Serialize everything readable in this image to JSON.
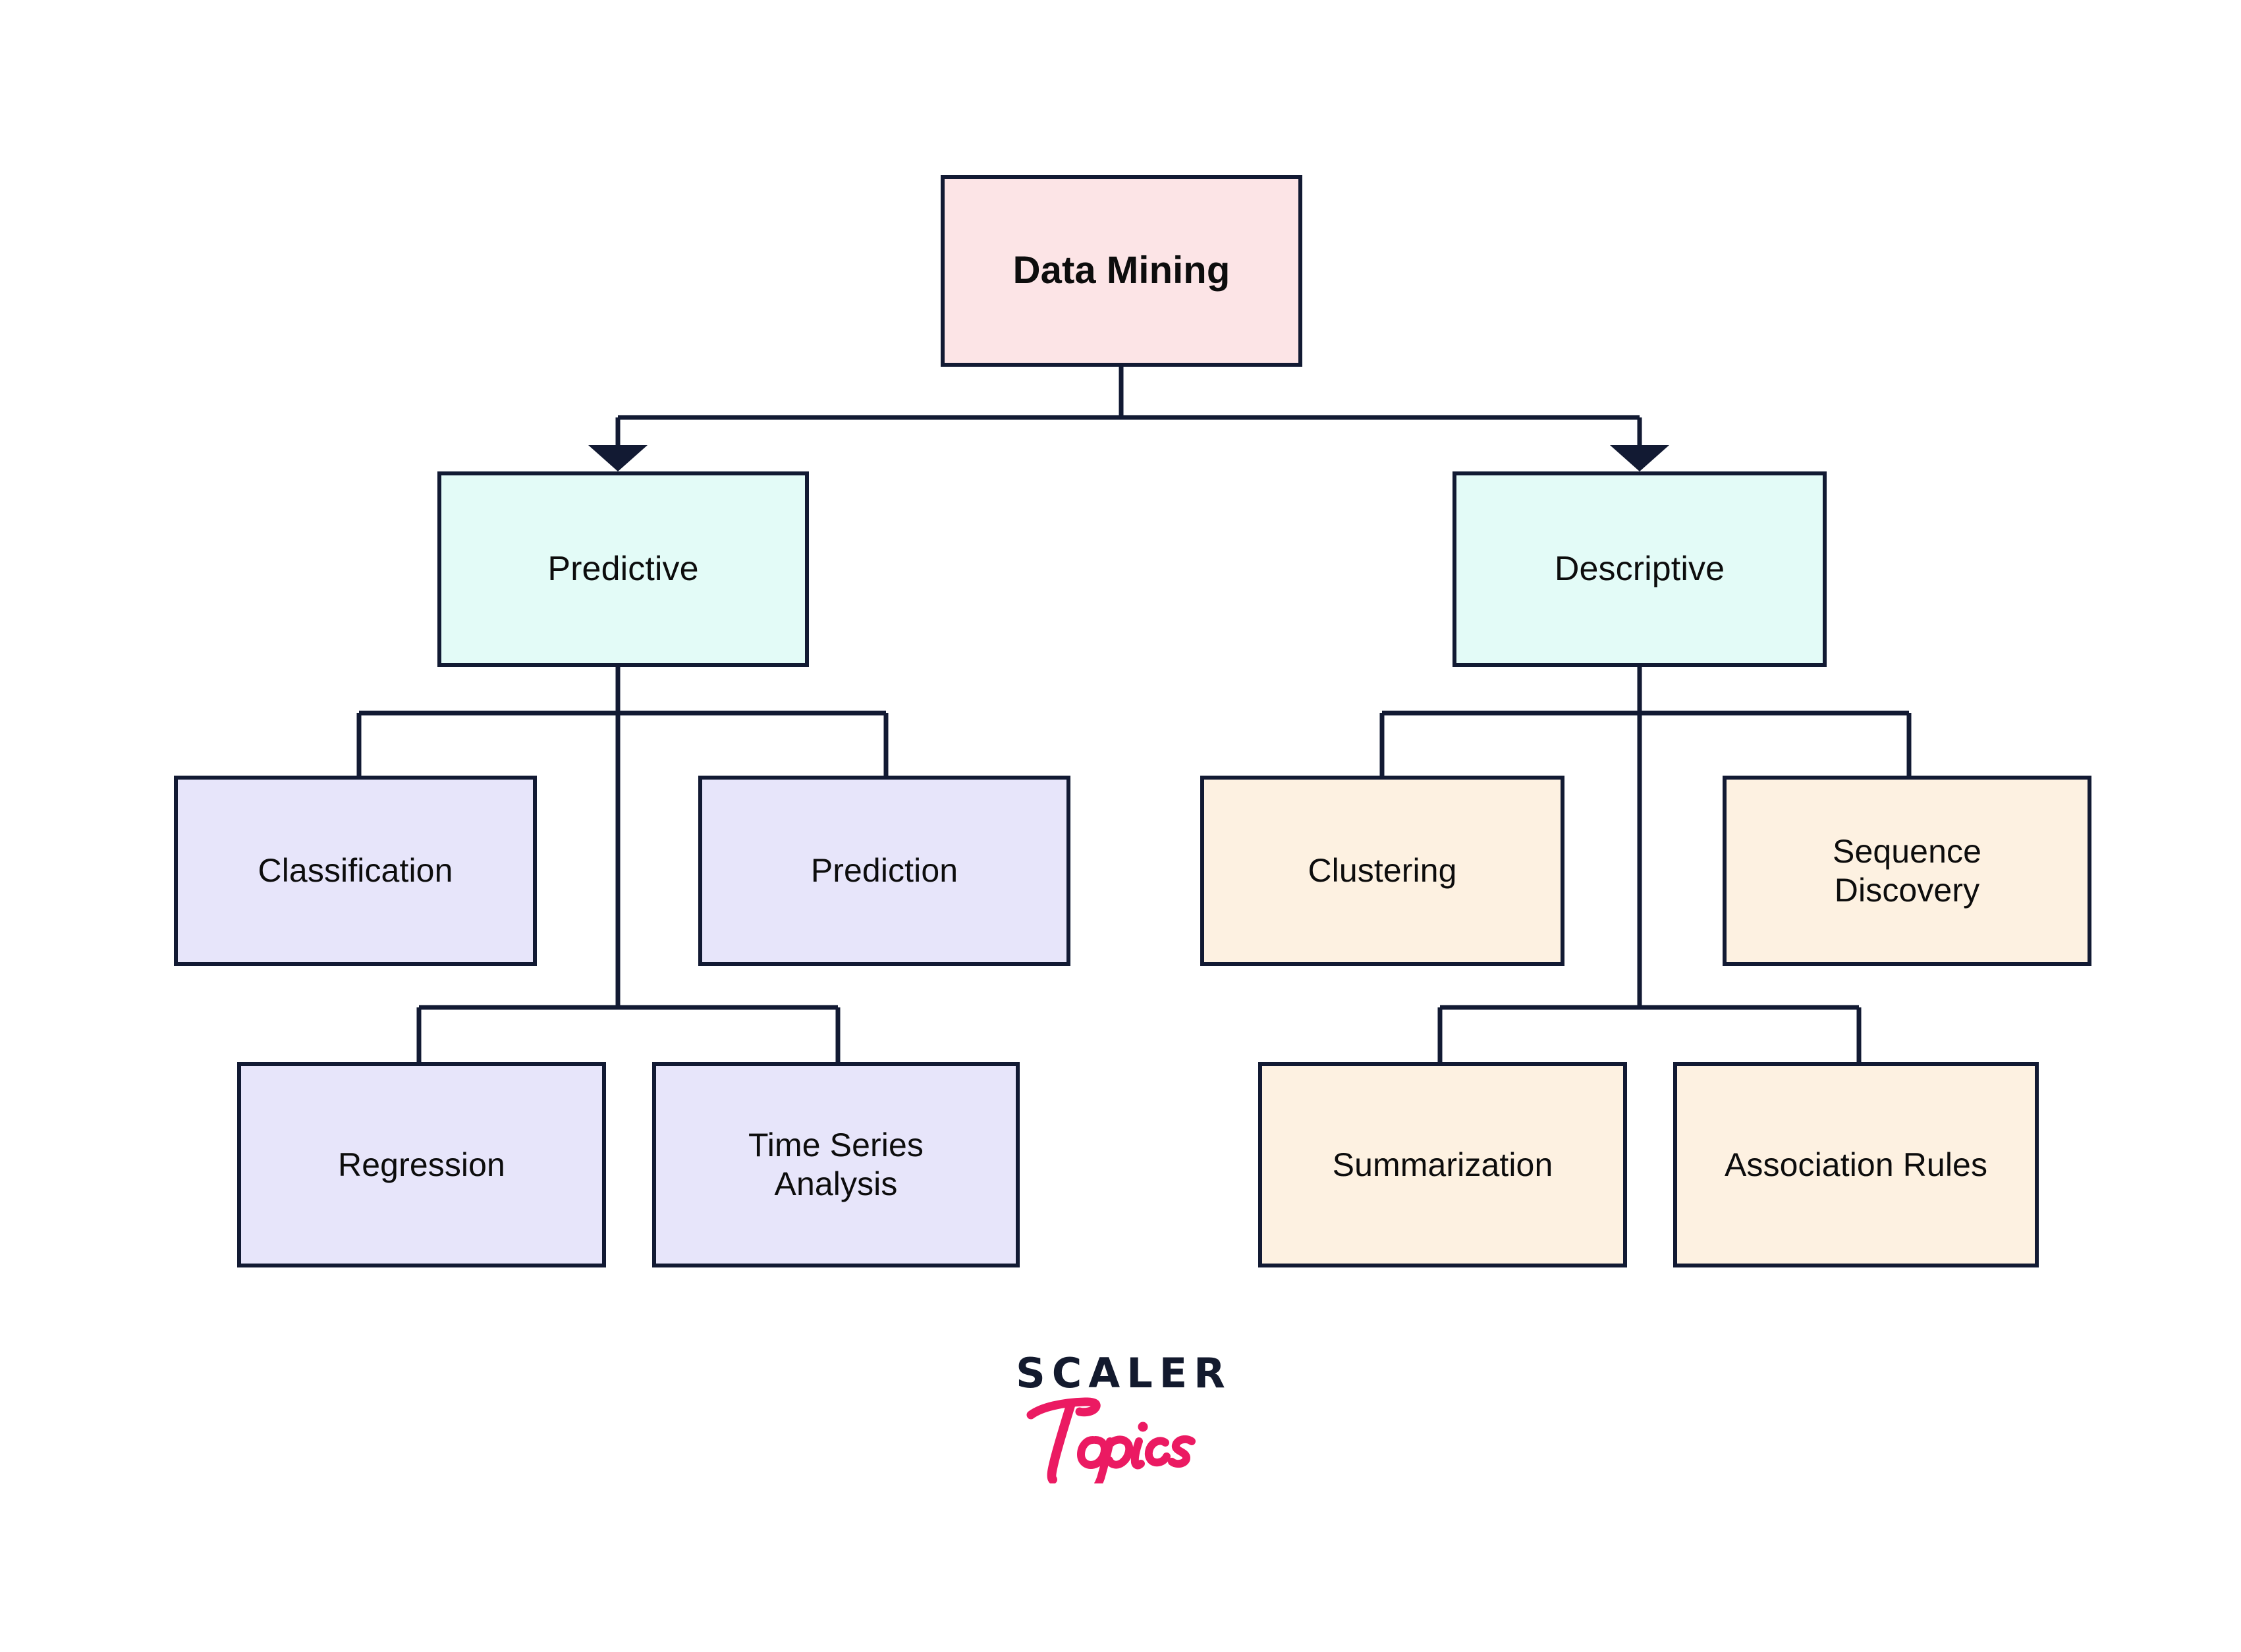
{
  "diagram": {
    "title": "Data Mining",
    "type": "hierarchy-tree",
    "orientation": "top-down",
    "background_color": "#ffffff",
    "line_color": "#121a33",
    "levels": 4
  },
  "palette": {
    "border": "#121a33",
    "root_fill": "#fce4e6",
    "branch_fill": "#e3fbf7",
    "predictive_children_fill": "#e7e5fa",
    "descriptive_children_fill": "#fdf1e1",
    "text": "#0d0d0d",
    "logo_navy": "#131a2e",
    "logo_pink": "#eb1a62"
  },
  "nodes": {
    "root": {
      "label": "Data Mining",
      "level": 1
    },
    "branches": [
      {
        "id": "predictive",
        "label": "Predictive",
        "level": 2
      },
      {
        "id": "descriptive",
        "label": "Descriptive",
        "level": 2
      }
    ],
    "predictive_children": [
      {
        "id": "classification",
        "label": "Classification",
        "level": 3
      },
      {
        "id": "prediction",
        "label": "Prediction",
        "level": 3
      },
      {
        "id": "regression",
        "label": "Regression",
        "level": 4
      },
      {
        "id": "time-series-analysis",
        "label": "Time Series\nAnalysis",
        "level": 4
      }
    ],
    "descriptive_children": [
      {
        "id": "clustering",
        "label": "Clustering",
        "level": 3
      },
      {
        "id": "sequence-discovery",
        "label": "Sequence\nDiscovery",
        "level": 3
      },
      {
        "id": "summarization",
        "label": "Summarization",
        "level": 4
      },
      {
        "id": "association-rules",
        "label": "Association Rules",
        "level": 4
      }
    ]
  },
  "edges": [
    {
      "from": "Data Mining",
      "to": "Predictive",
      "arrowhead": true
    },
    {
      "from": "Data Mining",
      "to": "Descriptive",
      "arrowhead": true
    },
    {
      "from": "Predictive",
      "to": "Classification",
      "arrowhead": false
    },
    {
      "from": "Predictive",
      "to": "Prediction",
      "arrowhead": false
    },
    {
      "from": "Predictive",
      "to": "Regression",
      "arrowhead": false
    },
    {
      "from": "Predictive",
      "to": "Time Series Analysis",
      "arrowhead": false
    },
    {
      "from": "Descriptive",
      "to": "Clustering",
      "arrowhead": false
    },
    {
      "from": "Descriptive",
      "to": "Sequence Discovery",
      "arrowhead": false
    },
    {
      "from": "Descriptive",
      "to": "Summarization",
      "arrowhead": false
    },
    {
      "from": "Descriptive",
      "to": "Association Rules",
      "arrowhead": false
    }
  ],
  "logo": {
    "wordmark": "SCALER",
    "script": "Topics"
  }
}
